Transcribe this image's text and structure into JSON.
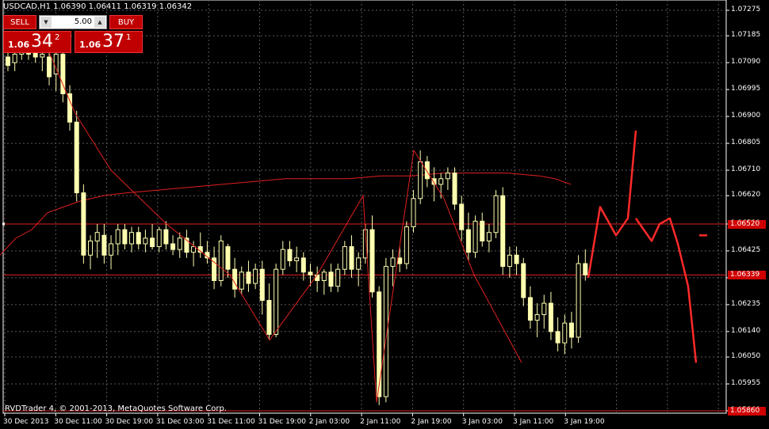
{
  "header": {
    "symbol_info": "USDCAD,H1  1.06390 1.06411 1.06319 1.06342"
  },
  "trade_panel": {
    "sell_label": "SELL",
    "buy_label": "BUY",
    "lot_value": "5.00",
    "sell_price": {
      "prefix": "1.06",
      "big": "34",
      "sup": "2"
    },
    "buy_price": {
      "prefix": "1.06",
      "big": "37",
      "sup": "1"
    }
  },
  "copyright": "RVDTrader 4, © 2001-2013, MetaQuotes Software Corp.",
  "colors": {
    "background": "#000000",
    "candle": "#ffffb0",
    "grid": "#5a5a5a",
    "indicator": "#e02020",
    "label_bg": "#d00000"
  },
  "chart_data": {
    "type": "candlestick",
    "symbol": "USDCAD",
    "timeframe": "H1",
    "y_ticks": [
      "1.07275",
      "1.07185",
      "1.07090",
      "1.06995",
      "1.06900",
      "1.06805",
      "1.06710",
      "1.06620",
      "1.06520",
      "1.06425",
      "1.06330",
      "1.06235",
      "1.06140",
      "1.06050",
      "1.05955",
      "1.05860"
    ],
    "ylim": [
      1.0586,
      1.07275
    ],
    "x_ticks": [
      "30 Dec 2013",
      "30 Dec 11:00",
      "30 Dec 19:00",
      "31 Dec 03:00",
      "31 Dec 11:00",
      "31 Dec 19:00",
      "2 Jan 03:00",
      "2 Jan 11:00",
      "2 Jan 19:00",
      "3 Jan 03:00",
      "3 Jan 11:00",
      "3 Jan 19:00"
    ],
    "horizontal_levels": [
      {
        "price": 1.0652,
        "label": "1.06520"
      },
      {
        "price": 1.0634,
        "label": "1.06339"
      },
      {
        "price": 1.0586,
        "label": "1.05860"
      }
    ],
    "candles": [
      [
        1.0711,
        1.0715,
        1.0706,
        1.0708
      ],
      [
        1.0709,
        1.0713,
        1.0706,
        1.0712
      ],
      [
        1.0712,
        1.0716,
        1.071,
        1.0714
      ],
      [
        1.0714,
        1.0716,
        1.071,
        1.0712
      ],
      [
        1.0713,
        1.0716,
        1.0709,
        1.0711
      ],
      [
        1.0711,
        1.0714,
        1.0706,
        1.0712
      ],
      [
        1.0711,
        1.0714,
        1.0701,
        1.0704
      ],
      [
        1.0705,
        1.0715,
        1.0699,
        1.0712
      ],
      [
        1.0712,
        1.0714,
        1.0695,
        1.0698
      ],
      [
        1.0698,
        1.0701,
        1.0685,
        1.0688
      ],
      [
        1.0688,
        1.0692,
        1.066,
        1.0663
      ],
      [
        1.0663,
        1.0666,
        1.0638,
        1.0641
      ],
      [
        1.0641,
        1.0648,
        1.0636,
        1.0646
      ],
      [
        1.0646,
        1.0652,
        1.064,
        1.0649
      ],
      [
        1.0648,
        1.0652,
        1.0638,
        1.0641
      ],
      [
        1.0641,
        1.0648,
        1.0636,
        1.0645
      ],
      [
        1.0645,
        1.0652,
        1.0641,
        1.065
      ],
      [
        1.065,
        1.0652,
        1.0643,
        1.0645
      ],
      [
        1.0645,
        1.0651,
        1.0642,
        1.0649
      ],
      [
        1.0649,
        1.0651,
        1.0643,
        1.0645
      ],
      [
        1.0645,
        1.065,
        1.0642,
        1.0647
      ],
      [
        1.0647,
        1.0652,
        1.0643,
        1.0644
      ],
      [
        1.0644,
        1.0651,
        1.0642,
        1.065
      ],
      [
        1.065,
        1.0653,
        1.0643,
        1.0645
      ],
      [
        1.0645,
        1.0648,
        1.0641,
        1.0643
      ],
      [
        1.0643,
        1.0649,
        1.064,
        1.0647
      ],
      [
        1.0647,
        1.065,
        1.064,
        1.0642
      ],
      [
        1.0642,
        1.0646,
        1.0637,
        1.0644
      ],
      [
        1.0644,
        1.0649,
        1.064,
        1.0642
      ],
      [
        1.0642,
        1.0646,
        1.0638,
        1.064
      ],
      [
        1.064,
        1.0644,
        1.0629,
        1.0632
      ],
      [
        1.0632,
        1.0648,
        1.063,
        1.0646
      ],
      [
        1.0644,
        1.0645,
        1.0633,
        1.0636
      ],
      [
        1.0636,
        1.064,
        1.0626,
        1.0629
      ],
      [
        1.0629,
        1.0637,
        1.0627,
        1.0635
      ],
      [
        1.0635,
        1.0639,
        1.0628,
        1.0631
      ],
      [
        1.0631,
        1.0638,
        1.0629,
        1.0636
      ],
      [
        1.0636,
        1.0639,
        1.062,
        1.0625
      ],
      [
        1.0625,
        1.0631,
        1.0611,
        1.0613
      ],
      [
        1.0613,
        1.0638,
        1.0612,
        1.0636
      ],
      [
        1.0636,
        1.0646,
        1.0634,
        1.0643
      ],
      [
        1.0643,
        1.0646,
        1.0637,
        1.0639
      ],
      [
        1.0639,
        1.0644,
        1.0635,
        1.064
      ],
      [
        1.064,
        1.0642,
        1.0632,
        1.0635
      ],
      [
        1.0635,
        1.0638,
        1.063,
        1.0634
      ],
      [
        1.0634,
        1.0637,
        1.0628,
        1.0632
      ],
      [
        1.0632,
        1.0636,
        1.0627,
        1.0635
      ],
      [
        1.0635,
        1.0638,
        1.0628,
        1.063
      ],
      [
        1.063,
        1.0638,
        1.0628,
        1.0636
      ],
      [
        1.0636,
        1.0646,
        1.0634,
        1.0644
      ],
      [
        1.0644,
        1.0648,
        1.0633,
        1.0636
      ],
      [
        1.0636,
        1.0642,
        1.063,
        1.064
      ],
      [
        1.064,
        1.0652,
        1.0638,
        1.065
      ],
      [
        1.065,
        1.0655,
        1.0626,
        1.0628
      ],
      [
        1.0628,
        1.063,
        1.0588,
        1.0591
      ],
      [
        1.0591,
        1.064,
        1.0589,
        1.0637
      ],
      [
        1.0637,
        1.0643,
        1.063,
        1.064
      ],
      [
        1.064,
        1.0644,
        1.0635,
        1.0638
      ],
      [
        1.0638,
        1.0653,
        1.0636,
        1.0651
      ],
      [
        1.0651,
        1.0664,
        1.0649,
        1.0661
      ],
      [
        1.0661,
        1.0678,
        1.0659,
        1.0674
      ],
      [
        1.0674,
        1.0676,
        1.0665,
        1.0668
      ],
      [
        1.0668,
        1.0672,
        1.066,
        1.0666
      ],
      [
        1.0666,
        1.067,
        1.0661,
        1.0668
      ],
      [
        1.0668,
        1.0672,
        1.0664,
        1.067
      ],
      [
        1.067,
        1.0672,
        1.0657,
        1.0659
      ],
      [
        1.0659,
        1.0662,
        1.0646,
        1.065
      ],
      [
        1.065,
        1.0656,
        1.0639,
        1.0642
      ],
      [
        1.0642,
        1.0655,
        1.064,
        1.0653
      ],
      [
        1.0653,
        1.0656,
        1.0644,
        1.0646
      ],
      [
        1.0646,
        1.0652,
        1.0642,
        1.0649
      ],
      [
        1.0649,
        1.0664,
        1.0647,
        1.0662
      ],
      [
        1.0662,
        1.0665,
        1.0634,
        1.0637
      ],
      [
        1.0637,
        1.0644,
        1.0633,
        1.0641
      ],
      [
        1.0641,
        1.0644,
        1.0634,
        1.0638
      ],
      [
        1.0638,
        1.064,
        1.0623,
        1.0626
      ],
      [
        1.0626,
        1.063,
        1.0615,
        1.0618
      ],
      [
        1.0618,
        1.0624,
        1.0612,
        1.062
      ],
      [
        1.062,
        1.0627,
        1.0615,
        1.0624
      ],
      [
        1.0624,
        1.0628,
        1.0611,
        1.0614
      ],
      [
        1.0614,
        1.0619,
        1.0607,
        1.061
      ],
      [
        1.061,
        1.062,
        1.0606,
        1.0617
      ],
      [
        1.0617,
        1.0621,
        1.0608,
        1.0612
      ],
      [
        1.0612,
        1.0641,
        1.061,
        1.0638
      ],
      [
        1.0638,
        1.0643,
        1.0632,
        1.0634
      ]
    ],
    "moving_average": [
      [
        0,
        1.0641
      ],
      [
        20,
        1.0647
      ],
      [
        40,
        1.065
      ],
      [
        60,
        1.0656
      ],
      [
        80,
        1.0658
      ],
      [
        100,
        1.066
      ],
      [
        130,
        1.0662
      ],
      [
        160,
        1.0663
      ],
      [
        200,
        1.0664
      ],
      [
        240,
        1.0665
      ],
      [
        280,
        1.0666
      ],
      [
        320,
        1.0667
      ],
      [
        360,
        1.0668
      ],
      [
        400,
        1.0668
      ],
      [
        440,
        1.0668
      ],
      [
        480,
        1.0669
      ],
      [
        520,
        1.0669
      ],
      [
        560,
        1.067
      ],
      [
        600,
        1.067
      ],
      [
        640,
        1.067
      ],
      [
        680,
        1.0669
      ],
      [
        700,
        1.0668
      ],
      [
        720,
        1.0666
      ]
    ],
    "zigzag": [
      [
        60,
        1.0714
      ],
      [
        95,
        1.0691
      ],
      [
        140,
        1.0671
      ],
      [
        210,
        1.0652
      ],
      [
        290,
        1.0634
      ],
      [
        340,
        1.0611
      ],
      [
        400,
        1.0634
      ],
      [
        458,
        1.0662
      ],
      [
        475,
        1.0589
      ],
      [
        522,
        1.0678
      ],
      [
        560,
        1.0661
      ],
      [
        598,
        1.0634
      ],
      [
        658,
        1.0603
      ]
    ],
    "forecast": {
      "segments": [
        [
          [
            742,
            1.0633
          ],
          [
            757,
            1.0658
          ],
          [
            767,
            1.0653
          ],
          [
            777,
            1.0648
          ],
          [
            792,
            1.0654
          ],
          [
            802,
            1.0685
          ]
        ],
        [
          [
            802,
            1.0654
          ],
          [
            812,
            1.065
          ],
          [
            822,
            1.0646
          ],
          [
            832,
            1.0652
          ],
          [
            845,
            1.0654
          ],
          [
            855,
            1.0645
          ],
          [
            868,
            1.063
          ],
          [
            878,
            1.0603
          ]
        ],
        [
          [
            882,
            1.0648
          ],
          [
            892,
            1.0648
          ]
        ]
      ]
    }
  }
}
